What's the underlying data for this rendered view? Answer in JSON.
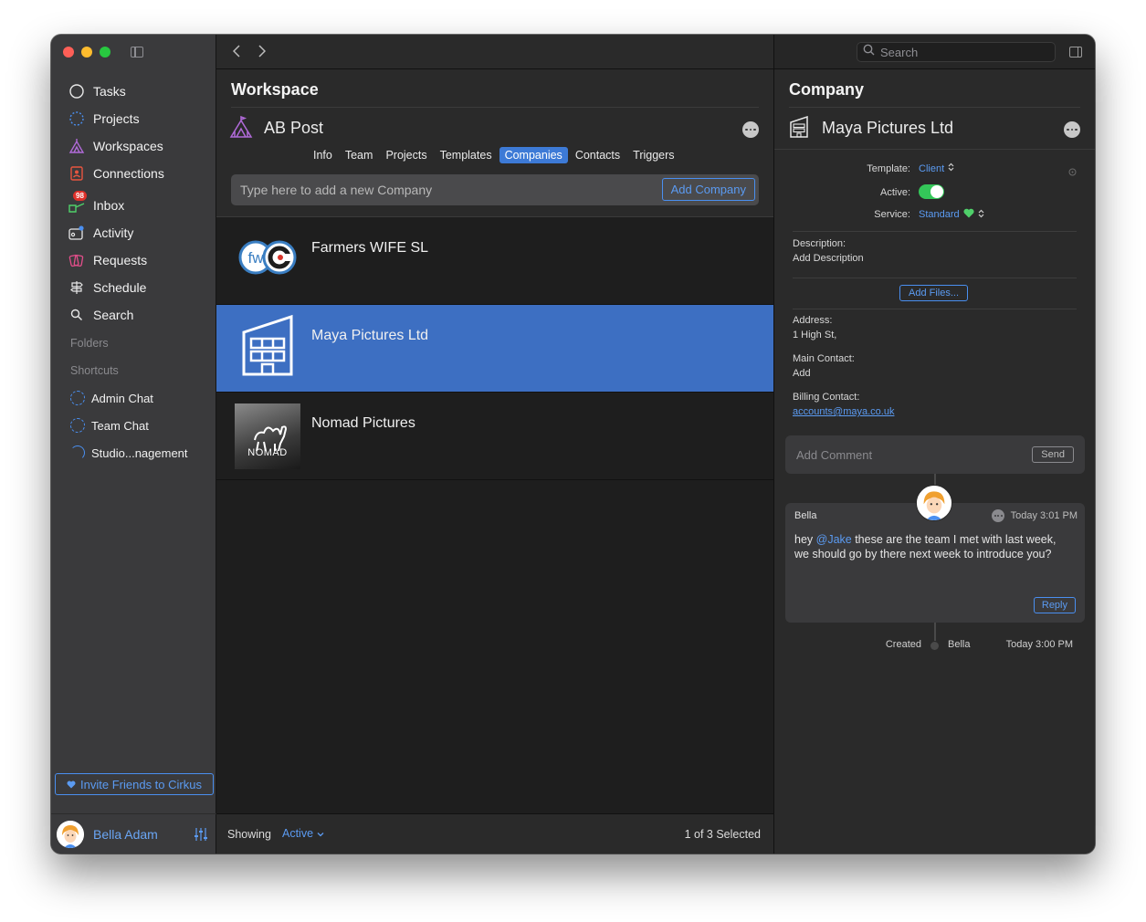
{
  "sidebar": {
    "nav": [
      {
        "label": "Tasks",
        "icon": "circle-icon"
      },
      {
        "label": "Projects",
        "icon": "dashed-circle-icon"
      },
      {
        "label": "Workspaces",
        "icon": "tent-icon"
      },
      {
        "label": "Connections",
        "icon": "contact-book-icon"
      },
      {
        "label": "Inbox",
        "icon": "inbox-icon",
        "badge": "98"
      },
      {
        "label": "Activity",
        "icon": "activity-icon"
      },
      {
        "label": "Requests",
        "icon": "cards-icon"
      },
      {
        "label": "Schedule",
        "icon": "signpost-icon"
      },
      {
        "label": "Search",
        "icon": "magnifier-icon"
      }
    ],
    "folders_label": "Folders",
    "shortcuts_label": "Shortcuts",
    "favorites": [
      {
        "label": "Admin Chat"
      },
      {
        "label": "Team Chat"
      },
      {
        "label": "Studio...nagement"
      }
    ],
    "invite_label": "Invite Friends to Cirkus",
    "user_name": "Bella Adam"
  },
  "middle": {
    "title": "Workspace",
    "workspace_name": "AB Post",
    "tabs": [
      {
        "label": "Info",
        "active": false
      },
      {
        "label": "Team",
        "active": false
      },
      {
        "label": "Projects",
        "active": false
      },
      {
        "label": "Templates",
        "active": false
      },
      {
        "label": "Companies",
        "active": true
      },
      {
        "label": "Contacts",
        "active": false
      },
      {
        "label": "Triggers",
        "active": false
      }
    ],
    "add_placeholder": "Type here to add a new Company",
    "add_button": "Add Company",
    "companies": [
      {
        "name": "Farmers WIFE SL",
        "logo": "fwc-logo",
        "selected": false
      },
      {
        "name": "Maya Pictures Ltd",
        "logo": "building-icon",
        "selected": true
      },
      {
        "name": "Nomad Pictures",
        "logo": "nomad-camel-logo",
        "selected": false,
        "logo_text": "NOMAD"
      }
    ],
    "footer": {
      "showing_label": "Showing",
      "filter_value": "Active",
      "selection": "1 of 3 Selected"
    }
  },
  "right": {
    "search_placeholder": "Search",
    "title": "Company",
    "company_name": "Maya Pictures Ltd",
    "template_label": "Template:",
    "template_value": "Client",
    "active_label": "Active:",
    "active_on": true,
    "service_label": "Service:",
    "service_value": "Standard",
    "description_label": "Description:",
    "description_value": "Add Description",
    "add_files_button": "Add Files...",
    "address_label": "Address:",
    "address_value": "1 High St,",
    "main_contact_label": "Main Contact:",
    "main_contact_value": "Add",
    "billing_contact_label": "Billing Contact:",
    "billing_contact_value": "accounts@maya.co.uk",
    "comment_placeholder": "Add Comment",
    "send_button": "Send",
    "comment": {
      "author": "Bella",
      "time": "Today 3:01 PM",
      "body_prefix": "hey ",
      "mention": "@Jake",
      "body_suffix": " these are the team I met with last week, we should go by there next week to introduce you?",
      "reply_button": "Reply"
    },
    "created": {
      "label": "Created",
      "author": "Bella",
      "time": "Today 3:00 PM"
    }
  },
  "colors": {
    "accent": "#4a8ff0",
    "selection": "#3d6fc2",
    "toggle_on": "#34c759",
    "badge": "#e0312b"
  }
}
